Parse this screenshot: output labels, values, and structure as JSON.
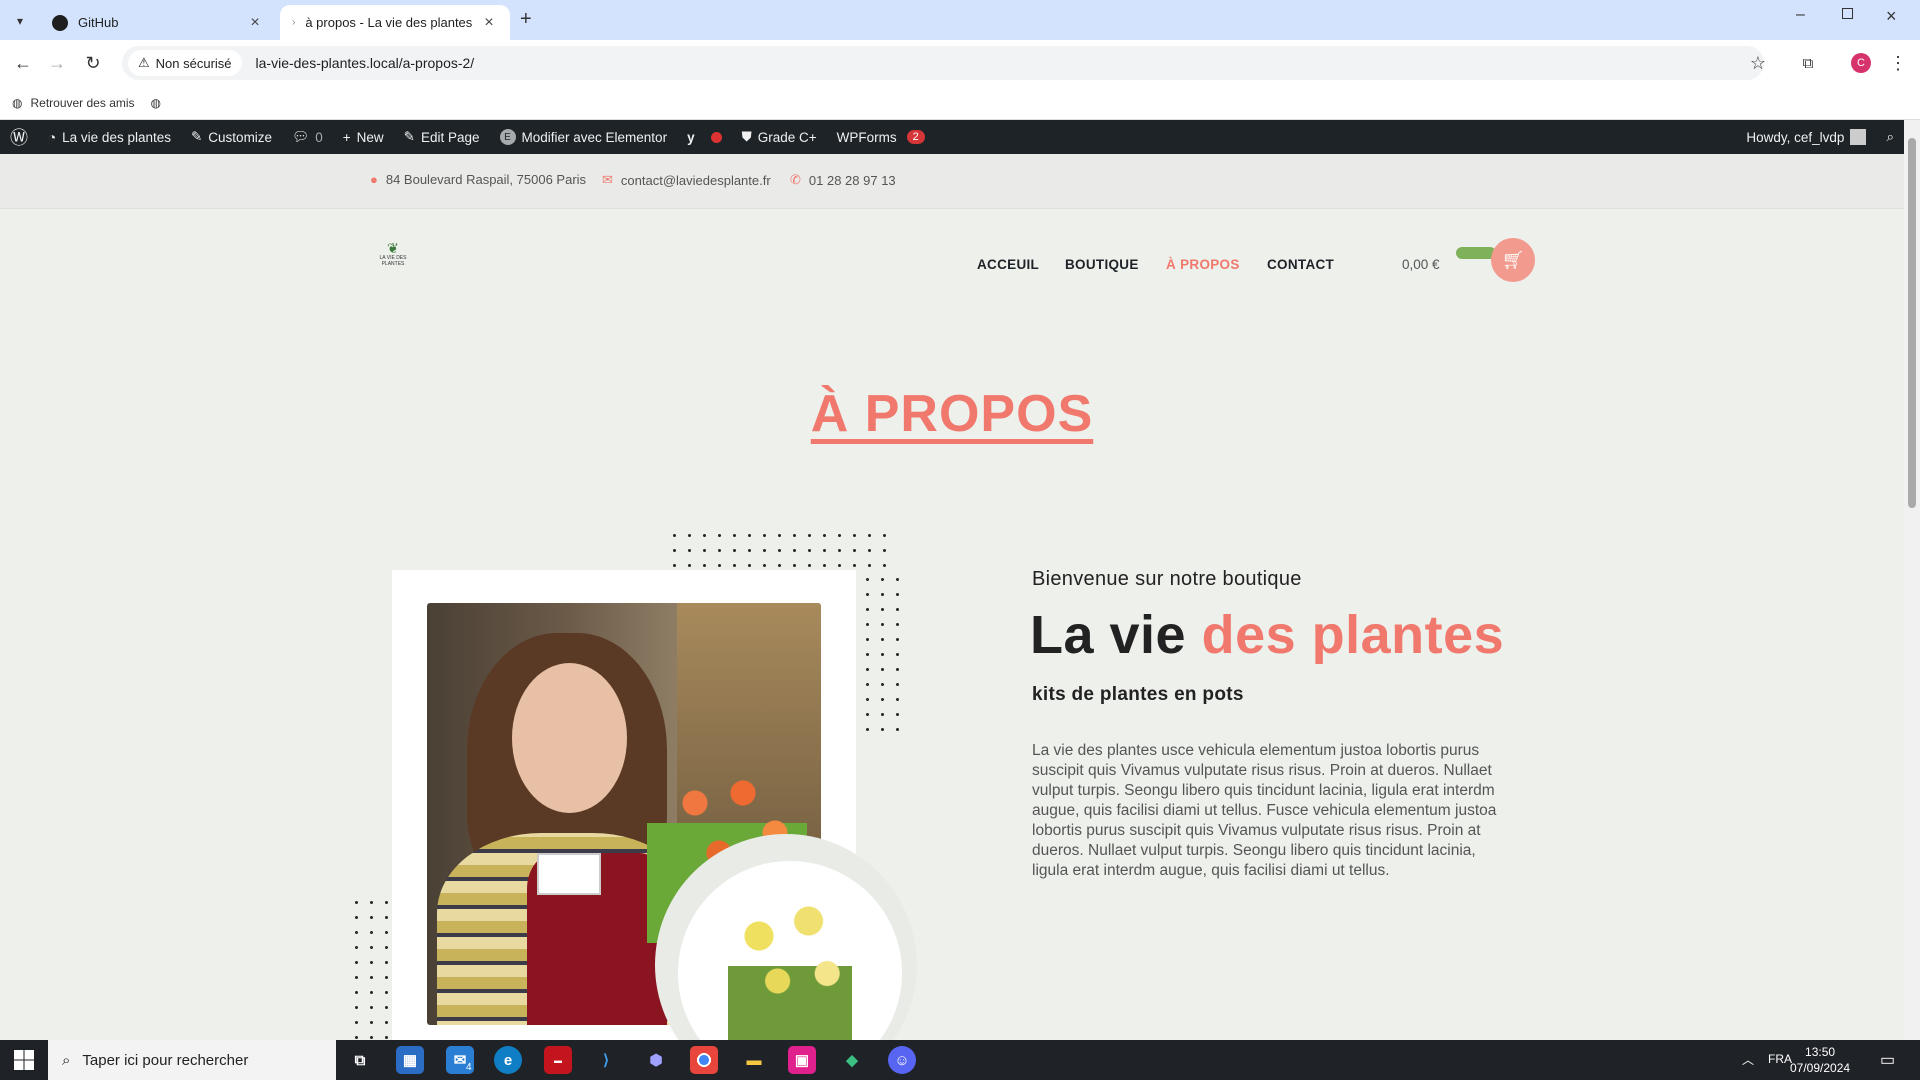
{
  "browser": {
    "tabs": [
      {
        "title": "GitHub",
        "icon": "github-icon"
      },
      {
        "title": "à propos - La vie des plantes",
        "icon": "page-icon"
      }
    ],
    "security_label": "Non sécurisé",
    "url": "la-vie-des-plantes.local/a-propos-2/",
    "bookmark": "Retrouver des amis",
    "profile_initial": "C"
  },
  "wpbar": {
    "site": "La vie des plantes",
    "customize": "Customize",
    "comments": "0",
    "new": "New",
    "edit": "Edit Page",
    "elementor": "Modifier avec Elementor",
    "grade": "Grade C+",
    "wpforms": "WPForms",
    "wpforms_count": "2",
    "howdy": "Howdy, cef_lvdp"
  },
  "topinfo": {
    "address": "84 Boulevard Raspail, 75006 Paris",
    "email": "contact@laviedesplante.fr",
    "phone": "01 28 28 97 13"
  },
  "header": {
    "logo_text": "LA VIE DES PLANTES",
    "nav": [
      "ACCEUIL",
      "BOUTIQUE",
      "À PROPOS",
      "CONTACT"
    ],
    "cart_total": "0,00 €"
  },
  "page": {
    "title": "À PROPOS",
    "welcome": "Bienvenue sur notre boutique",
    "brand_part1": "La vie",
    "brand_part2": "des plantes",
    "subtitle": "kits de plantes en pots",
    "paragraph": "La vie des plantes usce vehicula elementum justoa lobortis purus suscipit quis Vivamus vulputate risus risus. Proin at dueros. Nullaet vulput turpis. Seongu libero quis tincidunt lacinia, ligula erat interdm augue, quis facilisi diami ut tellus. Fusce vehicula elementum justoa lobortis purus suscipit quis Vivamus vulputate risus risus. Proin at dueros. Nullaet vulput turpis. Seongu libero quis tincidunt lacinia, ligula erat interdm augue, quis facilisi diami ut tellus."
  },
  "taskbar": {
    "search_placeholder": "Taper ici pour rechercher",
    "lang": "FRA",
    "time": "13:50",
    "date": "07/09/2024",
    "mail_badge": "4"
  },
  "colors": {
    "accent": "#f0786c",
    "wpbar": "#1d2327",
    "tabstrip": "#d3e3fd"
  }
}
